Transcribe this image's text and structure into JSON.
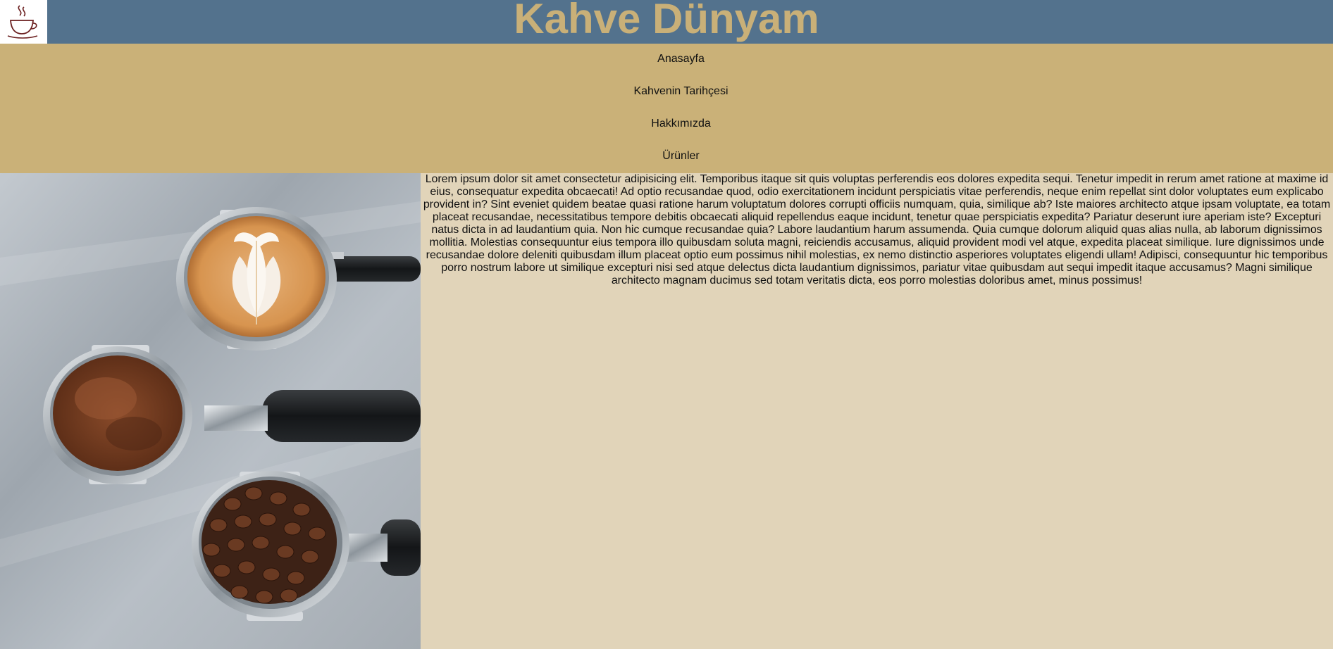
{
  "header": {
    "logo_icon": "coffee-cup-icon",
    "title": "Kahve Dünyam",
    "background_color": "#53728d",
    "title_color": "#c9b078"
  },
  "nav": {
    "background_color": "#cab178",
    "items": [
      {
        "label": "Anasayfa"
      },
      {
        "label": "Kahvenin Tarihçesi"
      },
      {
        "label": "Hakkımızda"
      },
      {
        "label": "Ürünler"
      }
    ]
  },
  "main": {
    "image_subject": "espresso-portafilters-latte-ground-coffee-beans",
    "background_color": "#e1d4b9",
    "paragraph": "Lorem ipsum dolor sit amet consectetur adipisicing elit. Temporibus itaque sit quis voluptas perferendis eos dolores expedita sequi. Tenetur impedit in rerum amet ratione at maxime id eius, consequatur expedita obcaecati! Ad optio recusandae quod, odio exercitationem incidunt perspiciatis vitae perferendis, neque enim repellat sint dolor voluptates eum explicabo provident in? Sint eveniet quidem beatae quasi ratione harum voluptatum dolores corrupti officiis numquam, quia, similique ab? Iste maiores architecto atque ipsam voluptate, ea totam placeat recusandae, necessitatibus tempore debitis obcaecati aliquid repellendus eaque incidunt, tenetur quae perspiciatis expedita? Pariatur deserunt iure aperiam iste? Excepturi natus dicta in ad laudantium quia. Non hic cumque recusandae quia? Labore laudantium harum assumenda. Quia cumque dolorum aliquid quas alias nulla, ab laborum dignissimos mollitia. Molestias consequuntur eius tempora illo quibusdam soluta magni, reiciendis accusamus, aliquid provident modi vel atque, expedita placeat similique. Iure dignissimos unde recusandae dolore deleniti quibusdam illum placeat optio eum possimus nihil molestias, ex nemo distinctio asperiores voluptates eligendi ullam! Adipisci, consequuntur hic temporibus porro nostrum labore ut similique excepturi nisi sed atque delectus dicta laudantium dignissimos, pariatur vitae quibusdam aut sequi impedit itaque accusamus? Magni similique architecto magnam ducimus sed totam veritatis dicta, eos porro molestias doloribus amet, minus possimus!"
  }
}
